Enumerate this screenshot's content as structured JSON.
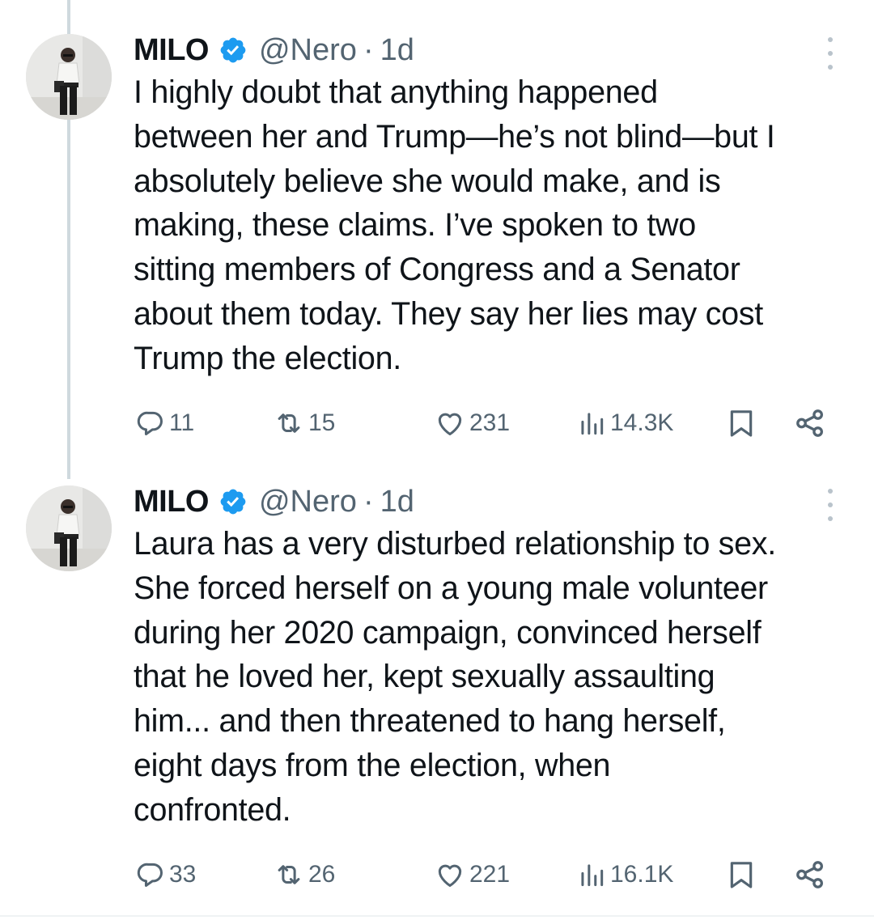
{
  "thread": {
    "tweets": [
      {
        "author": {
          "name": "MILO",
          "handle": "@Nero",
          "verified": true
        },
        "separator": "·",
        "time": "1d",
        "text": "I highly doubt that anything happened\nbetween her and Trump—he’s not blind—but I\nabsolutely believe she would make, and is\nmaking, these claims. I’ve spoken to two\nsitting members of Congress and a Senator\nabout them today. They say her lies may cost\nTrump the election.",
        "stats": {
          "replies": "11",
          "reposts": "15",
          "likes": "231",
          "views": "14.3K"
        }
      },
      {
        "author": {
          "name": "MILO",
          "handle": "@Nero",
          "verified": true
        },
        "separator": "·",
        "time": "1d",
        "text": "Laura has a very disturbed relationship to sex.\nShe forced herself on a young male volunteer\nduring her 2020 campaign, convinced herself\nthat he loved her, kept sexually assaulting\nhim... and then threatened to hang herself,\neight days from the election, when\nconfronted.",
        "stats": {
          "replies": "33",
          "reposts": "26",
          "likes": "221",
          "views": "16.1K"
        }
      }
    ]
  },
  "icons": {
    "reply": "reply-icon",
    "repost": "repost-icon",
    "like": "heart-icon",
    "views": "views-icon",
    "bookmark": "bookmark-icon",
    "share": "share-icon",
    "more": "more-vertical-icon",
    "verified": "verified-badge-icon"
  },
  "colors": {
    "text": "#0f1419",
    "secondary": "#536471",
    "verified": "#1d9bf0",
    "thread_line": "#cfd9de"
  }
}
